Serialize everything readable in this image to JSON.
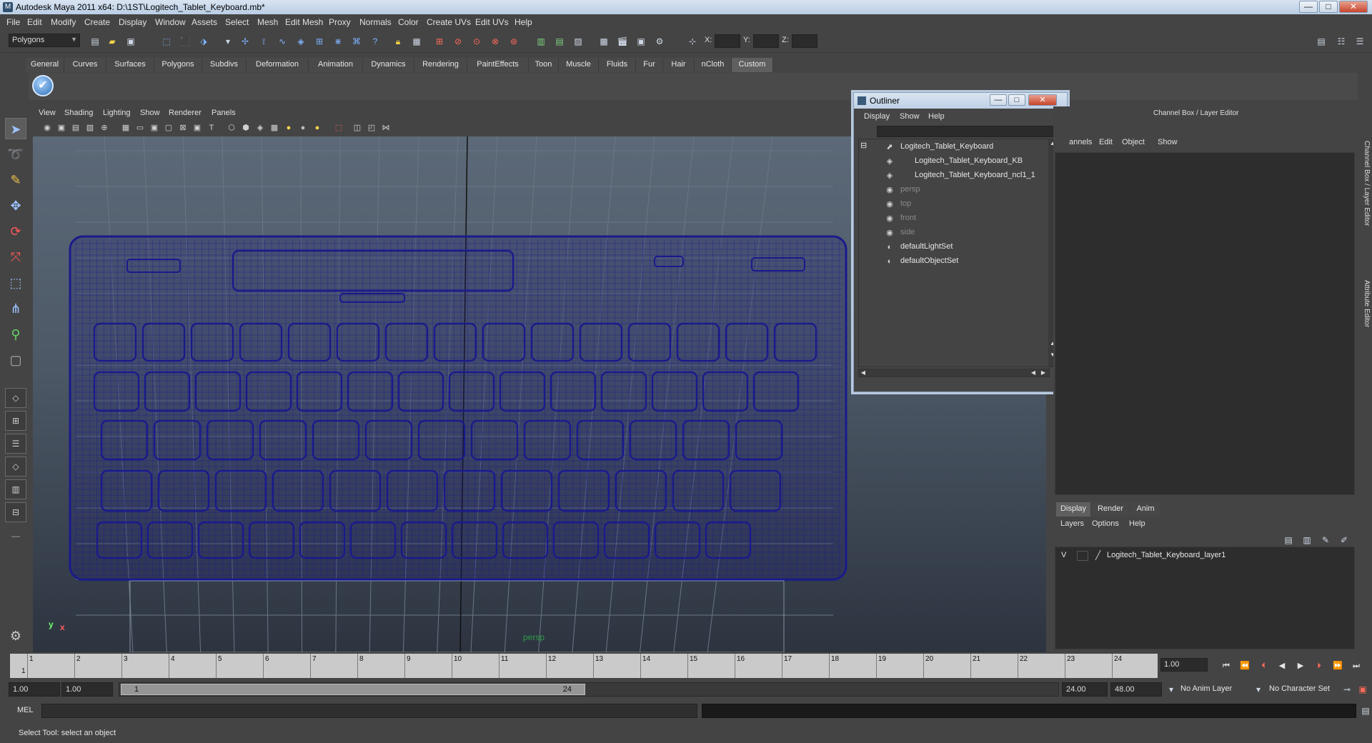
{
  "window": {
    "title": "Autodesk Maya 2011 x64: D:\\1ST\\Logitech_Tablet_Keyboard.mb*",
    "minimize": "—",
    "maximize": "□",
    "close": "✕"
  },
  "menubar": [
    "File",
    "Edit",
    "Modify",
    "Create",
    "Display",
    "Window",
    "Assets",
    "Select",
    "Mesh",
    "Edit Mesh",
    "Proxy",
    "Normals",
    "Color",
    "Create UVs",
    "Edit UVs",
    "Help"
  ],
  "statusline": {
    "mode": "Polygons",
    "x_label": "X:",
    "y_label": "Y:",
    "z_label": "Z:"
  },
  "shelf": {
    "tabs": [
      "General",
      "Curves",
      "Surfaces",
      "Polygons",
      "Subdivs",
      "Deformation",
      "Animation",
      "Dynamics",
      "Rendering",
      "PaintEffects",
      "Toon",
      "Muscle",
      "Fluids",
      "Fur",
      "Hair",
      "nCloth",
      "Custom"
    ],
    "active_tab": "Custom",
    "button_glyph": "✔"
  },
  "viewport": {
    "menu": [
      "View",
      "Shading",
      "Lighting",
      "Show",
      "Renderer",
      "Panels"
    ],
    "camera": "persp",
    "axis_x": "x",
    "axis_y": "y",
    "wire_color": "#1a1a8c"
  },
  "outliner": {
    "title": "Outliner",
    "menu": [
      "Display",
      "Show",
      "Help"
    ],
    "collapse_glyph": "⊟",
    "items": [
      {
        "label": "Logitech_Tablet_Keyboard",
        "icon": "transform-icon",
        "glyph": "⬈",
        "indent": 0,
        "dim": false
      },
      {
        "label": "Logitech_Tablet_Keyboard_KB",
        "icon": "mesh-icon",
        "glyph": "◈",
        "indent": 1,
        "dim": false
      },
      {
        "label": "Logitech_Tablet_Keyboard_ncl1_1",
        "icon": "mesh-icon",
        "glyph": "◈",
        "indent": 1,
        "dim": false
      },
      {
        "label": "persp",
        "icon": "camera-icon",
        "glyph": "◉",
        "indent": 0,
        "dim": true
      },
      {
        "label": "top",
        "icon": "camera-icon",
        "glyph": "◉",
        "indent": 0,
        "dim": true
      },
      {
        "label": "front",
        "icon": "camera-icon",
        "glyph": "◉",
        "indent": 0,
        "dim": true
      },
      {
        "label": "side",
        "icon": "camera-icon",
        "glyph": "◉",
        "indent": 0,
        "dim": true
      },
      {
        "label": "defaultLightSet",
        "icon": "set-icon",
        "glyph": "◐",
        "indent": 0,
        "dim": false
      },
      {
        "label": "defaultObjectSet",
        "icon": "set-icon",
        "glyph": "◐",
        "indent": 0,
        "dim": false
      }
    ]
  },
  "channelbox": {
    "title": "Channel Box / Layer Editor",
    "menu": [
      "annels",
      "Edit",
      "Object",
      "Show"
    ],
    "layer_tabs": [
      "Display",
      "Render",
      "Anim"
    ],
    "active_layer_tab": "Display",
    "layer_menu": [
      "Layers",
      "Options",
      "Help"
    ],
    "layer": {
      "visible": "V",
      "name": "Logitech_Tablet_Keyboard_layer1"
    }
  },
  "side_tabs": [
    "Channel Box / Layer Editor",
    "Attribute Editor"
  ],
  "timeline": {
    "ticks": [
      1,
      2,
      3,
      4,
      5,
      6,
      7,
      8,
      9,
      10,
      11,
      12,
      13,
      14,
      15,
      16,
      17,
      18,
      19,
      20,
      21,
      22,
      23,
      24
    ],
    "current_frame": "1",
    "current_time": "1.00"
  },
  "range": {
    "start": "1.00",
    "inner_start": "1.00",
    "handle_start": "1",
    "handle_end": "24",
    "end": "24.00",
    "outer_end": "48.00",
    "anim_layer": "No Anim Layer",
    "char_set": "No Character Set"
  },
  "cmdline": {
    "label": "MEL"
  },
  "helpline": {
    "text": "Select Tool: select an object"
  }
}
